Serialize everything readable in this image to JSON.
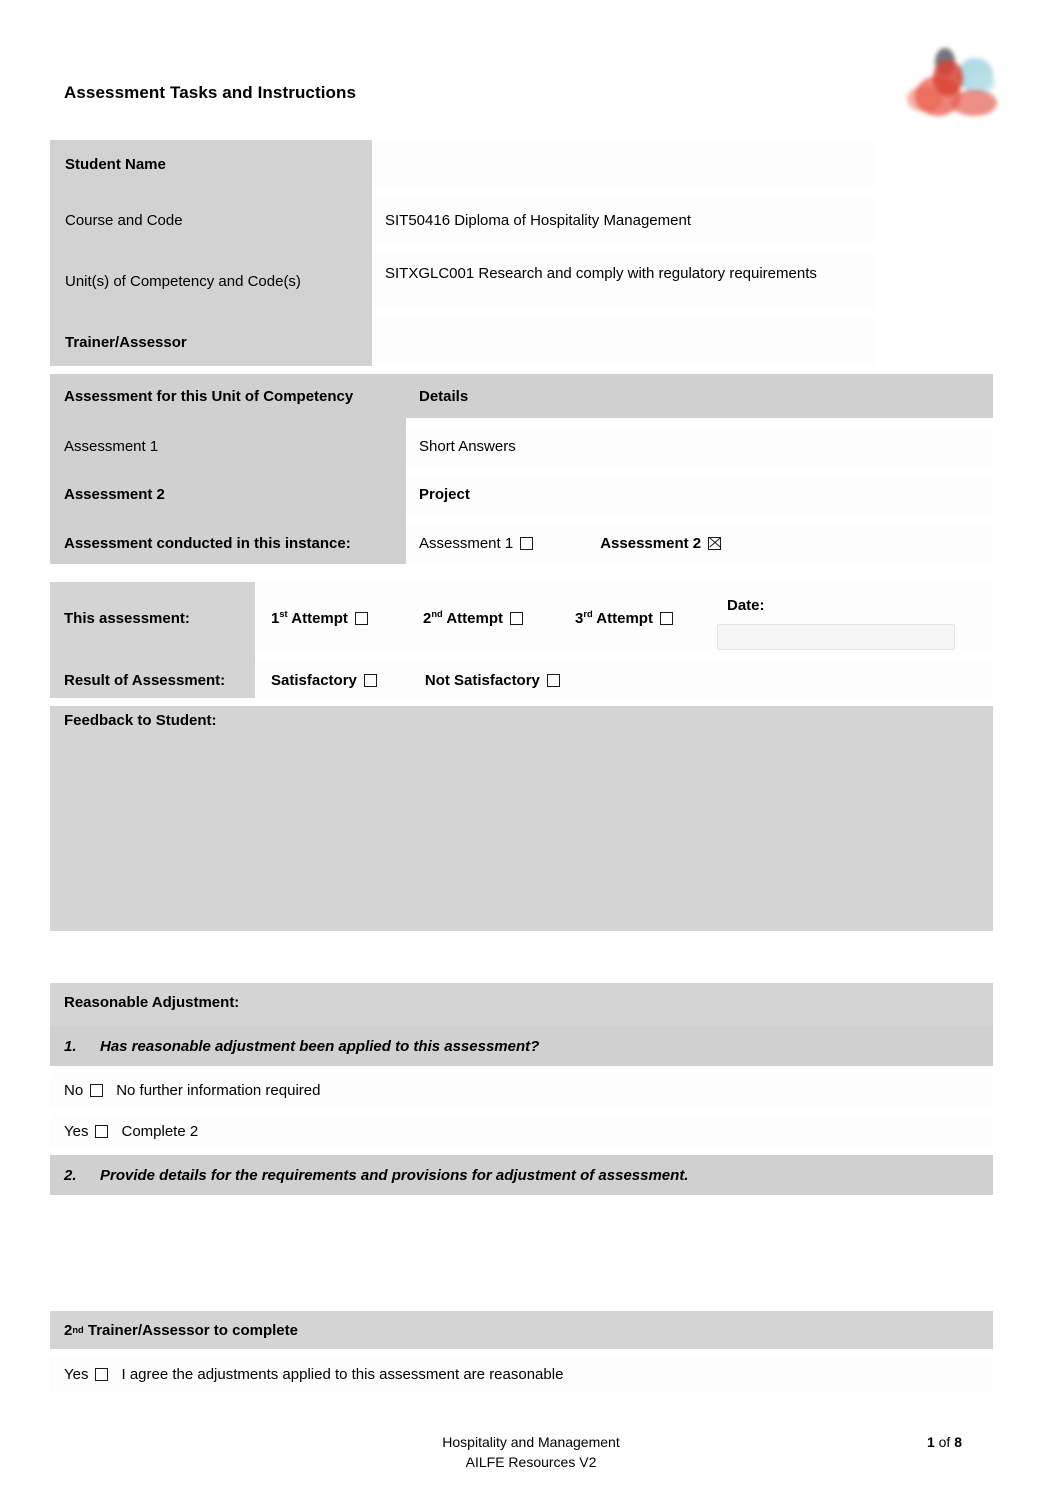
{
  "document": {
    "title": "Assessment Tasks and Instructions",
    "logo_name": "organisation-logo"
  },
  "student_details": {
    "rows": [
      {
        "label": "Student Name",
        "value": "",
        "label_bold": true
      },
      {
        "label": "Course and Code",
        "value": "SIT50416 Diploma of Hospitality Management",
        "label_bold": false
      },
      {
        "label": "Unit(s) of Competency and Code(s)",
        "value": "SITXGLC001 Research and comply with regulatory requirements",
        "label_bold": false
      },
      {
        "label": "Trainer/Assessor",
        "value": "",
        "label_bold": true
      }
    ]
  },
  "assessment_table": {
    "header": {
      "col1": "Assessment for this Unit of Competency",
      "col2": "Details"
    },
    "rows": [
      {
        "name": "Assessment 1",
        "details": "Short Answers",
        "bold": false
      },
      {
        "name": "Assessment 2",
        "details": "Project",
        "bold": true
      }
    ],
    "conducted": {
      "label": "Assessment conducted in this instance:",
      "option1": "Assessment 1",
      "option1_checked": false,
      "option2": "Assessment 2",
      "option2_checked": true
    }
  },
  "attempt_table": {
    "this_assessment_label": "This assessment:",
    "attempts": [
      {
        "ord": "1",
        "sup": "st",
        "word": "Attempt",
        "checked": false
      },
      {
        "ord": "2",
        "sup": "nd",
        "word": "Attempt",
        "checked": false
      },
      {
        "ord": "3",
        "sup": "rd",
        "word": "Attempt",
        "checked": false
      }
    ],
    "date_label": "Date:",
    "date_value": "",
    "result_label": "Result of Assessment:",
    "result_options": [
      {
        "label": "Satisfactory",
        "checked": false
      },
      {
        "label": "Not Satisfactory",
        "checked": false
      }
    ],
    "feedback_label": "Feedback to Student:",
    "feedback_value": ""
  },
  "reasonable_adjustment": {
    "heading": "Reasonable Adjustment:",
    "q1_num": "1.",
    "q1_text": "Has reasonable adjustment been applied to this assessment?",
    "no_label": "No",
    "no_text": "No further information required",
    "no_checked": false,
    "yes_label": "Yes",
    "yes_text": "Complete 2",
    "yes_checked": false,
    "q2_num": "2.",
    "q2_text": "Provide details for the requirements and provisions for adjustment of assessment.",
    "details_value": "",
    "second_assessor_ord": "2",
    "second_assessor_sup": "nd",
    "second_assessor_heading": "Trainer/Assessor to complete",
    "agree_label": "Yes",
    "agree_text": "I agree the adjustments applied to this assessment are reasonable",
    "agree_checked": false
  },
  "footer": {
    "line1": "Hospitality and Management",
    "line2": "AILFE Resources V2",
    "page_current": "1",
    "page_of": "of",
    "page_total": "8"
  },
  "colors": {
    "label_gray": "#d2d2d2",
    "header_gray": "#d0d0d0",
    "block_gray": "#d4d4d4",
    "white": "#ffffff"
  }
}
